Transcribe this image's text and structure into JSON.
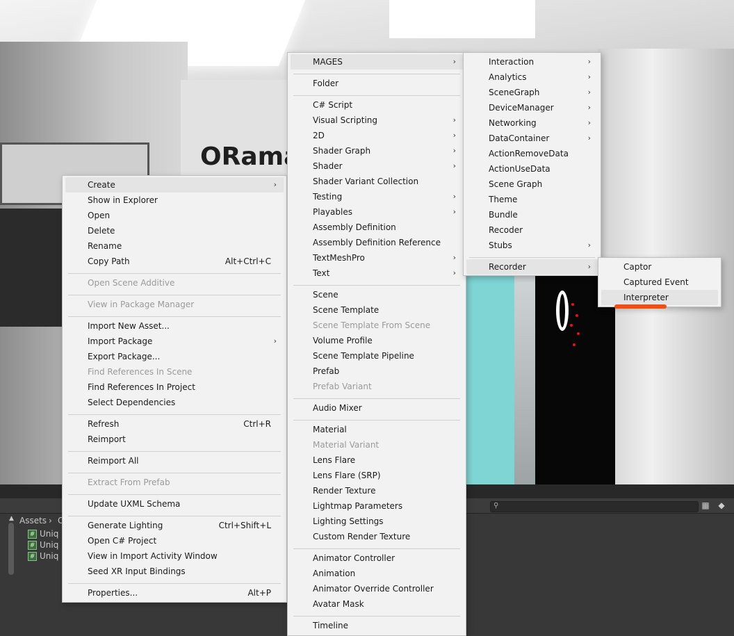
{
  "scene": {
    "brand_text": "ORama"
  },
  "panel": {
    "breadcrumb": [
      "Assets",
      "C"
    ],
    "files": [
      "Uniq",
      "Uniq",
      "Uniq"
    ]
  },
  "menu1": {
    "items": [
      {
        "label": "Create",
        "submenu": true,
        "highlight": true
      },
      {
        "label": "Show in Explorer"
      },
      {
        "label": "Open"
      },
      {
        "label": "Delete"
      },
      {
        "label": "Rename"
      },
      {
        "label": "Copy Path",
        "shortcut": "Alt+Ctrl+C"
      },
      {
        "label": "Open Scene Additive",
        "disabled": true
      },
      {
        "label": "View in Package Manager",
        "disabled": true
      },
      {
        "label": "Import New Asset..."
      },
      {
        "label": "Import Package",
        "submenu": true
      },
      {
        "label": "Export Package..."
      },
      {
        "label": "Find References In Scene",
        "disabled": true
      },
      {
        "label": "Find References In Project"
      },
      {
        "label": "Select Dependencies"
      },
      {
        "label": "Refresh",
        "shortcut": "Ctrl+R"
      },
      {
        "label": "Reimport"
      },
      {
        "label": "Reimport All"
      },
      {
        "label": "Extract From Prefab",
        "disabled": true
      },
      {
        "label": "Update UXML Schema"
      },
      {
        "label": "Generate Lighting",
        "shortcut": "Ctrl+Shift+L"
      },
      {
        "label": "Open C# Project"
      },
      {
        "label": "View in Import Activity Window"
      },
      {
        "label": "Seed XR Input Bindings"
      },
      {
        "label": "Properties...",
        "shortcut": "Alt+P"
      }
    ]
  },
  "menu2": {
    "items": [
      {
        "label": "MAGES",
        "submenu": true,
        "highlight": true
      },
      {
        "label": "Folder"
      },
      {
        "label": "C# Script"
      },
      {
        "label": "Visual Scripting",
        "submenu": true
      },
      {
        "label": "2D",
        "submenu": true
      },
      {
        "label": "Shader Graph",
        "submenu": true
      },
      {
        "label": "Shader",
        "submenu": true
      },
      {
        "label": "Shader Variant Collection"
      },
      {
        "label": "Testing",
        "submenu": true
      },
      {
        "label": "Playables",
        "submenu": true
      },
      {
        "label": "Assembly Definition"
      },
      {
        "label": "Assembly Definition Reference"
      },
      {
        "label": "TextMeshPro",
        "submenu": true
      },
      {
        "label": "Text",
        "submenu": true
      },
      {
        "label": "Scene"
      },
      {
        "label": "Scene Template"
      },
      {
        "label": "Scene Template From Scene",
        "disabled": true
      },
      {
        "label": "Volume Profile"
      },
      {
        "label": "Scene Template Pipeline"
      },
      {
        "label": "Prefab"
      },
      {
        "label": "Prefab Variant",
        "disabled": true
      },
      {
        "label": "Audio Mixer"
      },
      {
        "label": "Material"
      },
      {
        "label": "Material Variant",
        "disabled": true
      },
      {
        "label": "Lens Flare"
      },
      {
        "label": "Lens Flare (SRP)"
      },
      {
        "label": "Render Texture"
      },
      {
        "label": "Lightmap Parameters"
      },
      {
        "label": "Lighting Settings"
      },
      {
        "label": "Custom Render Texture"
      },
      {
        "label": "Animator Controller"
      },
      {
        "label": "Animation"
      },
      {
        "label": "Animator Override Controller"
      },
      {
        "label": "Avatar Mask"
      },
      {
        "label": "Timeline"
      }
    ]
  },
  "menu3": {
    "items": [
      {
        "label": "Interaction",
        "submenu": true
      },
      {
        "label": "Analytics",
        "submenu": true
      },
      {
        "label": "SceneGraph",
        "submenu": true
      },
      {
        "label": "DeviceManager",
        "submenu": true
      },
      {
        "label": "Networking",
        "submenu": true
      },
      {
        "label": "DataContainer",
        "submenu": true
      },
      {
        "label": "ActionRemoveData"
      },
      {
        "label": "ActionUseData"
      },
      {
        "label": "Scene Graph"
      },
      {
        "label": "Theme"
      },
      {
        "label": "Bundle"
      },
      {
        "label": "Recoder"
      },
      {
        "label": "Stubs",
        "submenu": true
      },
      {
        "label": "Recorder",
        "submenu": true,
        "highlight": true
      }
    ]
  },
  "menu4": {
    "items": [
      {
        "label": "Captor"
      },
      {
        "label": "Captured Event"
      },
      {
        "label": "Interpreter",
        "highlight": true
      }
    ]
  },
  "colors": {
    "menu_bg": "#f2f2f2",
    "highlight": "#e4e4e4",
    "annotation": "#f04e12"
  }
}
